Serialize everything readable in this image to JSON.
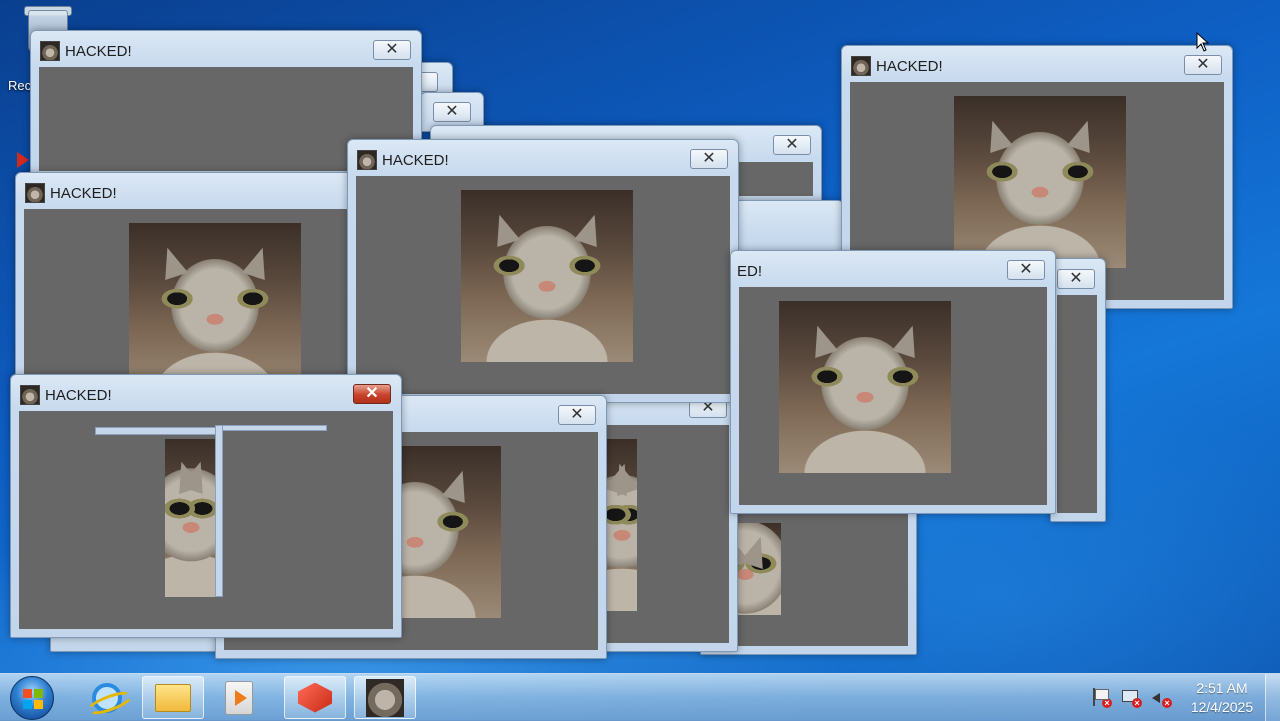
{
  "desktop": {
    "recycle_bin_label": "Rec"
  },
  "window_title": "HACKED!",
  "window_title_partial": "ED!",
  "close_glyph": "✕",
  "taskbar": {
    "items": [
      "internet-explorer",
      "windows-explorer",
      "media-player",
      "red-app",
      "hacked-cat-app"
    ]
  },
  "clock": {
    "time": "2:51 AM",
    "date": "12/4/2025"
  },
  "colors": {
    "client_gray": "#676767",
    "titlebar": "#c8daee",
    "close_active": "#c7432b"
  }
}
